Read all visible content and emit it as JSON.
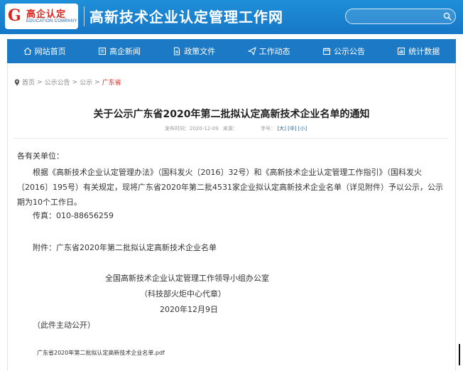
{
  "header": {
    "logo_text": "高企认定",
    "logo_subtext": "EDUCATION COMPANY",
    "logo_mark": "G",
    "site_title": "高新技术企业认定管理工作网",
    "search_value": ""
  },
  "nav": {
    "items": [
      {
        "label": "网站首页",
        "icon": "home-icon"
      },
      {
        "label": "高企新闻",
        "icon": "news-icon"
      },
      {
        "label": "政策文件",
        "icon": "document-icon"
      },
      {
        "label": "工作动态",
        "icon": "send-icon"
      },
      {
        "label": "公示公告",
        "icon": "announcement-icon"
      },
      {
        "label": "统计数据",
        "icon": "chart-icon"
      }
    ]
  },
  "breadcrumb": {
    "home": "首页",
    "sep": ">",
    "level1": "公示公告",
    "level2": "公示",
    "current": "广东省"
  },
  "article": {
    "title": "关于公示广东省2020年第二批拟认定高新技术企业名单的通知",
    "publish_label": "发布时间：",
    "publish_date": "2020-12-09",
    "source_label": "来源：",
    "font_label": "字号：",
    "font_large": "[大]",
    "font_medium": "[中]",
    "font_small": "[小]",
    "salutation": "各有关单位：",
    "paragraph": "根据《高新技术企业认定管理办法》（国科发火〔2016〕32号）和《高新技术企业认定管理工作指引》（国科发火〔2016〕195号）有关规定，现将广东省2020年第二批4531家企业拟认定高新技术企业名单（详见附件）予以公示，公示期为10个工作日。",
    "fax": "传真：010-88656259",
    "attachment_line": "附件：广东省2020年第二批拟认定高新技术企业名单",
    "signature_org": "全国高新技术企业认定管理工作领导小组办公室",
    "signature_sub": "（科技部火炬中心代章）",
    "signature_date": "2020年12月9日",
    "disclosure": "（此件主动公开）",
    "attachment_file": "广东省2020年第二批拟认定高新技术企业名单.pdf"
  },
  "colors": {
    "header_blue": "#1677c7",
    "nav_blue": "#1b79c6",
    "accent_red": "#d7261e",
    "link_blue": "#1a5ea8"
  }
}
